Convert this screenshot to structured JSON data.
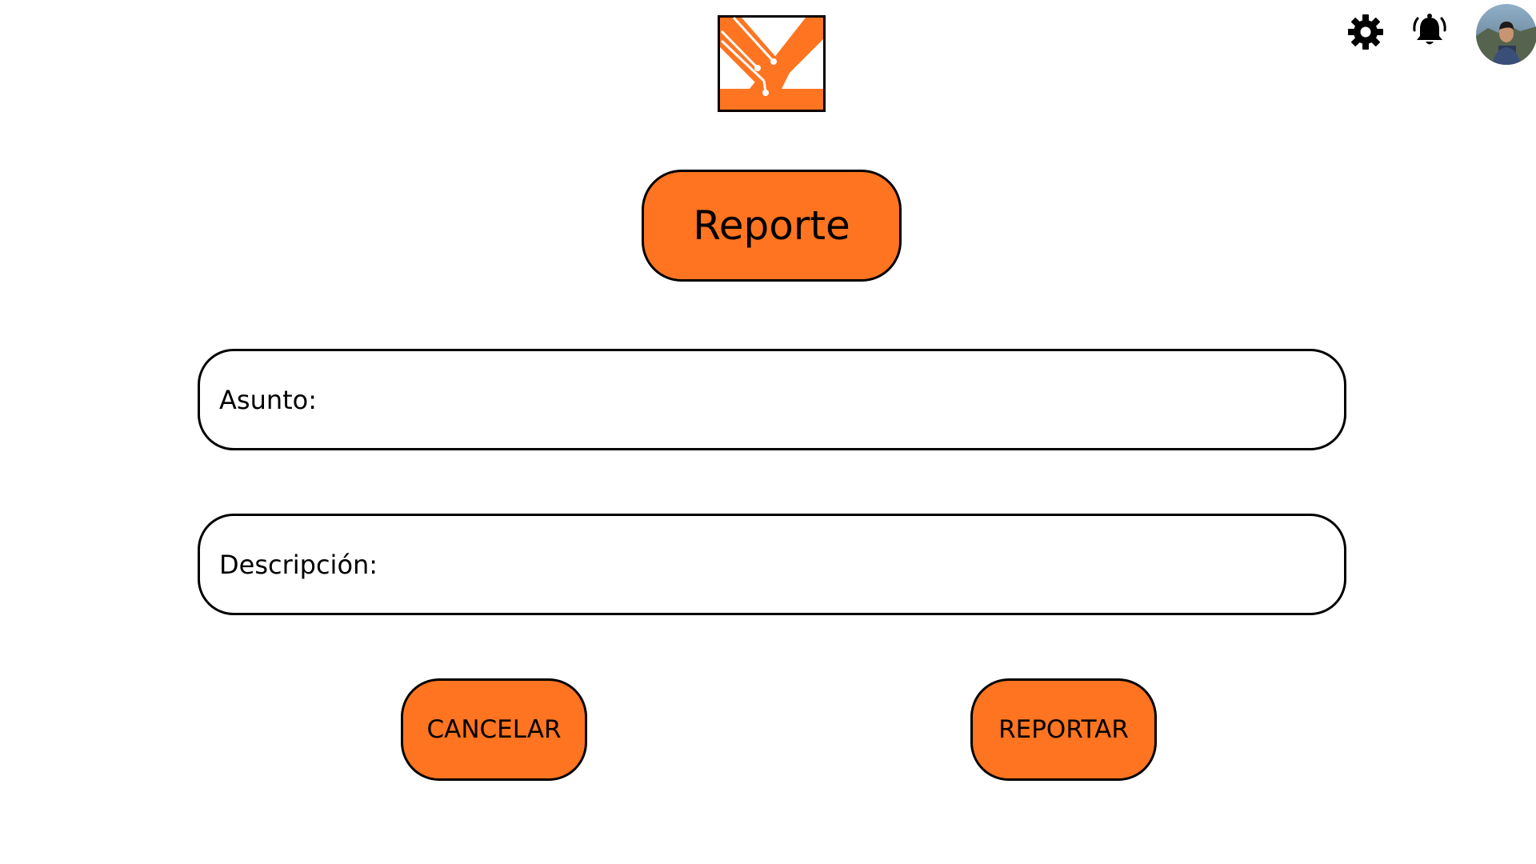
{
  "header": {
    "logo_icon": "brand-logo-icon",
    "settings_icon": "gear-icon",
    "notifications_icon": "bell-icon",
    "avatar_icon": "user-avatar"
  },
  "title": "Reporte",
  "form": {
    "subject_label": "Asunto:",
    "subject_value": "",
    "description_label": "Descripción:",
    "description_value": ""
  },
  "actions": {
    "cancel_label": "CANCELAR",
    "report_label": "REPORTAR"
  },
  "colors": {
    "accent": "#ff7420",
    "border": "#000000",
    "background": "#ffffff"
  }
}
